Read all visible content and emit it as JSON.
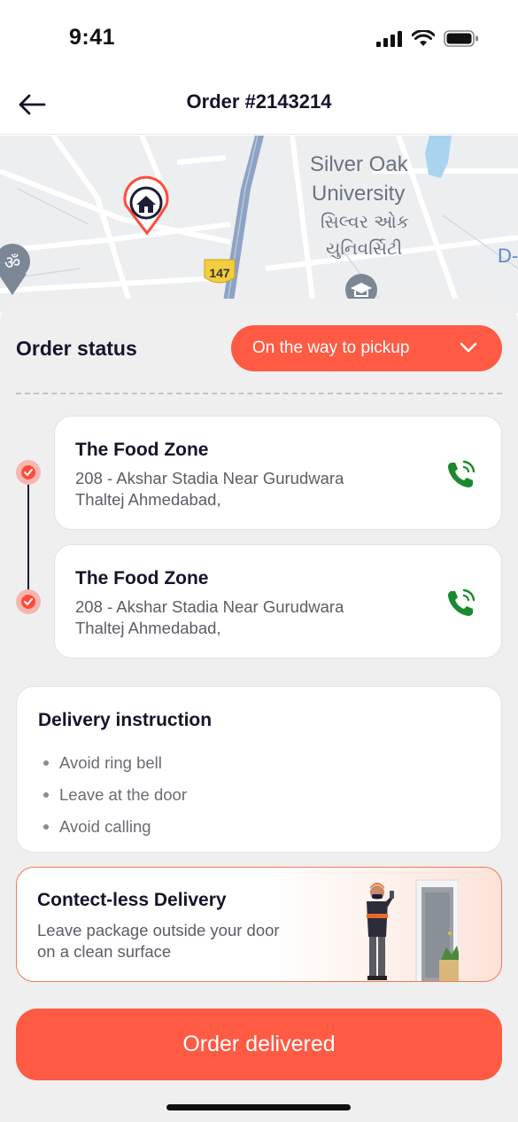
{
  "status_bar": {
    "time": "9:41"
  },
  "header": {
    "title": "Order #2143214"
  },
  "map": {
    "labels": {
      "poi_line1": "Silver Oak",
      "poi_line2": "University",
      "poi_gujarati1": "સિલ્વર ઓક",
      "poi_gujarati2": "યુનિવર્સિટી",
      "road_shield": "147",
      "edge_letter": "D-"
    }
  },
  "order_status": {
    "label": "Order status",
    "selected": "On the way to pickup"
  },
  "locations": [
    {
      "name": "The Food Zone",
      "address_line1": "208 - Akshar Stadia Near Gurudwara",
      "address_line2": "Thaltej  Ahmedabad,"
    },
    {
      "name": "The Food Zone",
      "address_line1": "208 - Akshar Stadia Near Gurudwara",
      "address_line2": "Thaltej  Ahmedabad,"
    }
  ],
  "delivery_instruction": {
    "title": "Delivery instruction",
    "items": [
      "Avoid ring bell",
      "Leave at the door",
      "Avoid calling"
    ]
  },
  "contactless": {
    "title": "Contect-less Delivery",
    "subtitle": "Leave package outside your door on a clean surface"
  },
  "action": {
    "label": "Order delivered"
  },
  "colors": {
    "accent": "#ff5a44",
    "call_green": "#1a8a2e",
    "text_dark": "#14142b"
  },
  "icons": {
    "back": "arrow-left-icon",
    "chevron": "chevron-down-icon",
    "call": "phone-call-icon",
    "check": "check-icon",
    "home_pin": "home-pin-icon"
  }
}
